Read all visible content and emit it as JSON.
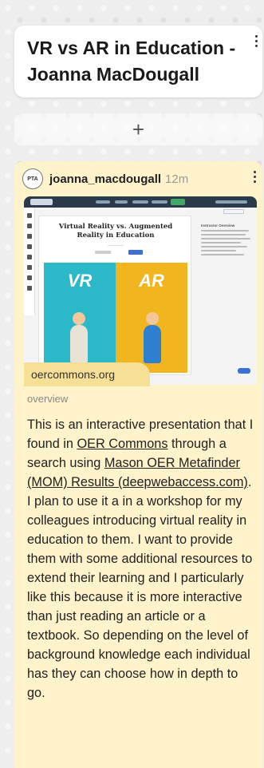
{
  "board": {
    "title": "VR vs AR in Education - Joanna MacDougall"
  },
  "add_post": {
    "label": "+"
  },
  "post": {
    "author": "joanna_macdougall",
    "time": "12m",
    "avatar_text": "PTA",
    "link_domain": "oercommons.org",
    "kind": "overview",
    "preview": {
      "slide_title": "Virtual Reality vs. Augmented Reality in Education",
      "vr_label": "VR",
      "ar_label": "AR",
      "side_title": "Instructor Overview"
    },
    "body": {
      "text_1": "This is an interactive presentation that I found in ",
      "link_1": "OER Commons",
      "text_2": " through a search using ",
      "link_2": "Mason OER Metafinder (MOM) Results (deepwebaccess.com)",
      "text_3": ". I plan to use it a in a workshop for my colleagues introducing virtual reality in education to them. I want to provide them with some additional resources to extend their learning and I particularly like this because it is more interactive than just reading an article or a textbook. So depending on the level of background knowledge each individual has they can choose how in depth to go."
    }
  },
  "colors": {
    "post_background": "#fff3cc",
    "domain_badge": "#f6df96",
    "vr_panel": "#2bb9c9",
    "ar_panel": "#f0b51f"
  },
  "icons": {
    "title_menu": "more-vertical-icon",
    "post_menu": "more-vertical-icon",
    "add": "plus-icon"
  }
}
